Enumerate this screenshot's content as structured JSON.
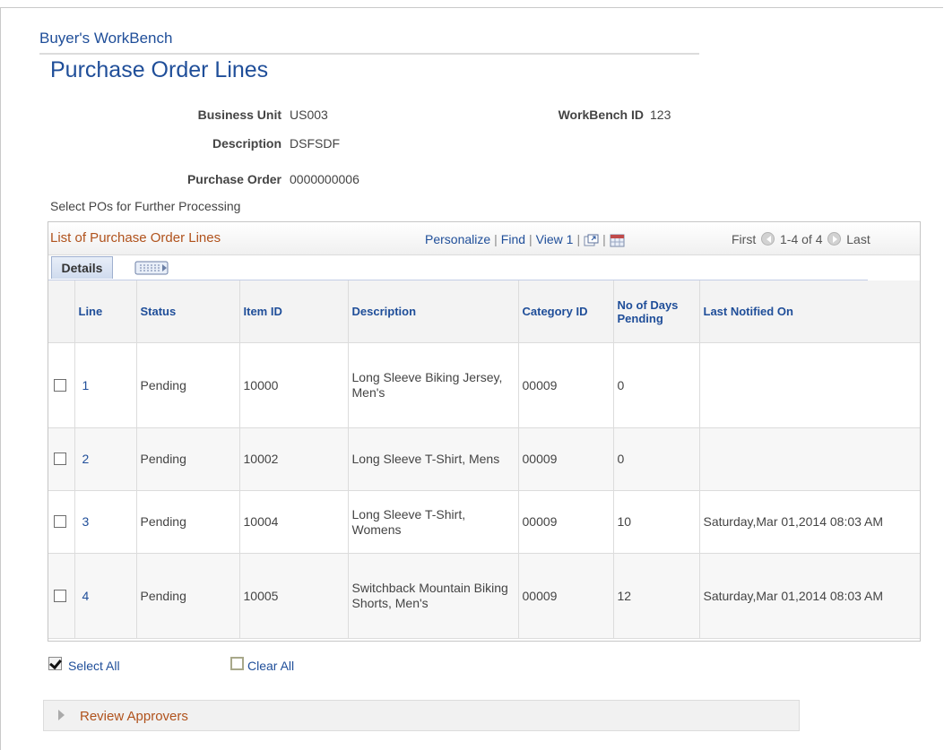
{
  "breadcrumb": "Buyer's WorkBench",
  "page_title": "Purchase Order Lines",
  "fields": {
    "business_unit_label": "Business Unit",
    "business_unit_value": "US003",
    "workbench_id_label": "WorkBench ID",
    "workbench_id_value": "123",
    "description_label": "Description",
    "description_value": "DSFSDF",
    "purchase_order_label": "Purchase Order",
    "purchase_order_value": "0000000006"
  },
  "hint": "Select POs for Further Processing",
  "grid": {
    "title": "List of Purchase Order Lines",
    "nav": {
      "personalize": "Personalize",
      "find": "Find",
      "view": "View 1"
    },
    "pager": {
      "first": "First",
      "range": "1-4 of 4",
      "last": "Last"
    },
    "tabs": {
      "details": "Details"
    },
    "columns": {
      "line": "Line",
      "status": "Status",
      "item_id": "Item ID",
      "description": "Description",
      "category_id": "Category ID",
      "days_pending": "No of Days Pending",
      "last_notified": "Last Notified On"
    },
    "rows": [
      {
        "line": "1",
        "status": "Pending",
        "item_id": "10000",
        "description": "Long Sleeve Biking Jersey, Men's",
        "category_id": "00009",
        "days_pending": "0",
        "last_notified": ""
      },
      {
        "line": "2",
        "status": "Pending",
        "item_id": "10002",
        "description": "Long Sleeve T-Shirt, Mens",
        "category_id": "00009",
        "days_pending": "0",
        "last_notified": ""
      },
      {
        "line": "3",
        "status": "Pending",
        "item_id": "10004",
        "description": "Long Sleeve T-Shirt, Womens",
        "category_id": "00009",
        "days_pending": "10",
        "last_notified": "Saturday,Mar 01,2014 08:03 AM"
      },
      {
        "line": "4",
        "status": "Pending",
        "item_id": "10005",
        "description": "Switchback Mountain Biking Shorts, Men's",
        "category_id": "00009",
        "days_pending": "12",
        "last_notified": "Saturday,Mar 01,2014 08:03 AM"
      }
    ]
  },
  "actions": {
    "select_all": "Select All",
    "clear_all": "Clear All"
  },
  "review_section": "Review Approvers",
  "icons": {
    "zoom": "zoom-grid-icon",
    "download": "download-spreadsheet-icon",
    "show_all_columns": "show-all-columns-icon",
    "prev": "previous-row-icon",
    "next": "next-row-icon",
    "expand": "expand-section-icon"
  },
  "colors": {
    "link": "#1f4e99",
    "section_title": "#b0521c"
  }
}
